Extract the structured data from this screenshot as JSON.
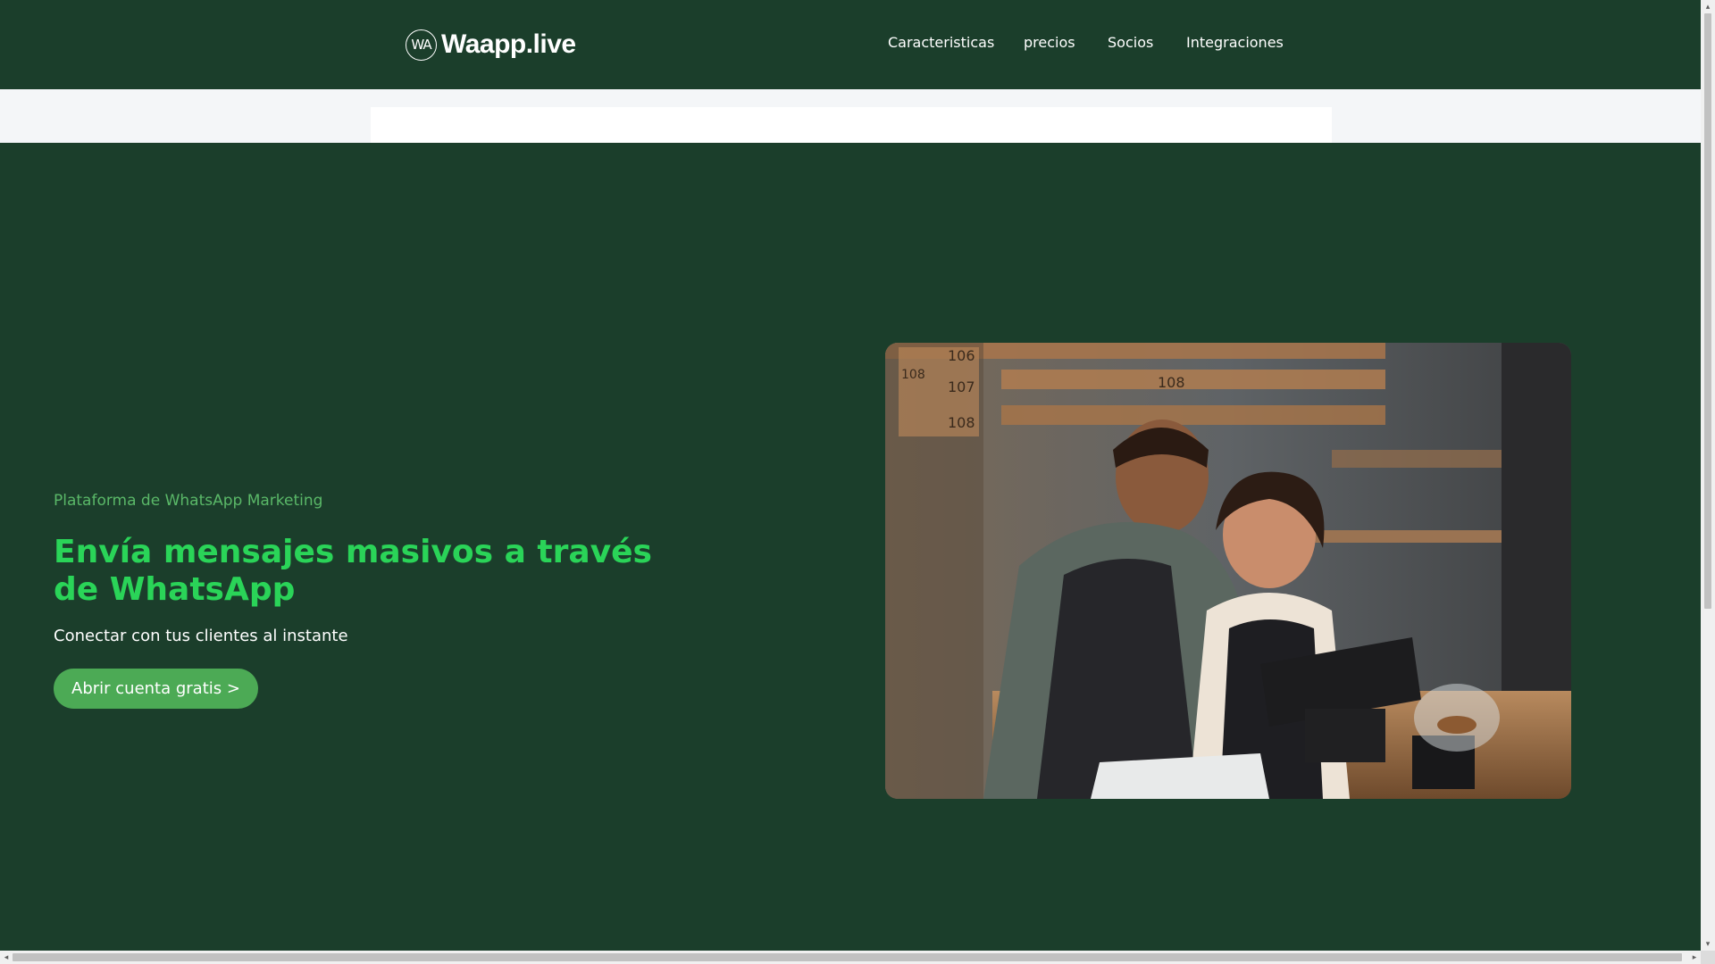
{
  "header": {
    "logo": {
      "badge": "WA",
      "name": "Waapp.live"
    },
    "nav": [
      {
        "label": "Caracteristicas"
      },
      {
        "label": "precios"
      },
      {
        "label": "Socios"
      },
      {
        "label": "Integraciones"
      }
    ]
  },
  "hero": {
    "eyebrow": "Plataforma de WhatsApp Marketing",
    "headline": "Envía mensajes masivos a través de WhatsApp",
    "subheadline": "Conectar con tus clientes al instante",
    "cta_label": "Abrir cuenta gratis >",
    "image": {
      "subject": "two-cafe-workers-at-pos-terminal",
      "locker_numbers": [
        "106",
        "108",
        "107",
        "108",
        "108"
      ]
    }
  },
  "scrollbars": {
    "left_arrow": "◂",
    "right_arrow": "▸",
    "up_arrow": "▴",
    "down_arrow": "▾"
  },
  "colors": {
    "background": "#1b3e2b",
    "headline": "#2ad458",
    "eyebrow": "#5ab868",
    "cta": "#4caa55",
    "strip": "#f4f6f8"
  }
}
